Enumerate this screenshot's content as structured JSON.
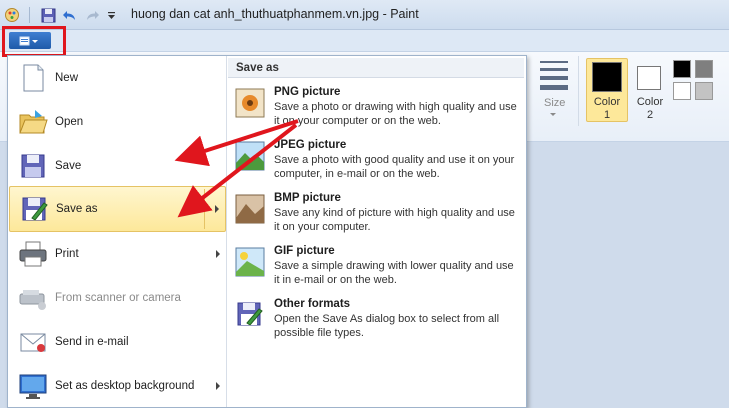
{
  "window": {
    "title": "huong dan cat anh_thuthuatphanmem.vn.jpg - Paint"
  },
  "ribbon": {
    "size_label": "Size",
    "color1_label": "Color",
    "color1_num": "1",
    "color2_label": "Color",
    "color2_num": "2",
    "palette": [
      "#000000",
      "#7f7f7f",
      "#880015",
      "#ed1c24",
      "#ffffff",
      "#c3c3c3",
      "#b97a57",
      "#ffaec9"
    ],
    "color1": "#000000",
    "color2": "#ffffff",
    "active_color_bg": "#fde89a"
  },
  "menu": {
    "items": [
      {
        "label": "New",
        "key": "N",
        "icon": "new-document-icon"
      },
      {
        "label": "Open",
        "key": "O",
        "icon": "open-folder-icon"
      },
      {
        "label": "Save",
        "key": "S",
        "icon": "save-icon"
      },
      {
        "label": "Save as",
        "key": "a",
        "icon": "save-as-icon",
        "active": true
      },
      {
        "label": "Print",
        "key": "P",
        "icon": "printer-icon"
      },
      {
        "label": "From scanner or camera",
        "key": "m",
        "icon": "scanner-icon",
        "disabled": true
      },
      {
        "label": "Send in e-mail",
        "key": "d",
        "icon": "email-icon"
      },
      {
        "label": "Set as desktop background",
        "key": "b",
        "icon": "desktop-icon"
      }
    ],
    "save_as_header": "Save as",
    "save_as_options": [
      {
        "title": "PNG picture",
        "desc": "Save a photo or drawing with high quality and use it on your computer or on the web.",
        "icon": "png-icon"
      },
      {
        "title": "JPEG picture",
        "desc": "Save a photo with good quality and use it on your computer, in e-mail or on the web.",
        "icon": "jpeg-icon"
      },
      {
        "title": "BMP picture",
        "desc": "Save any kind of picture with high quality and use it on your computer.",
        "icon": "bmp-icon"
      },
      {
        "title": "GIF picture",
        "desc": "Save a simple drawing with lower quality and use it in e-mail or on the web.",
        "icon": "gif-icon"
      },
      {
        "title": "Other formats",
        "desc": "Open the Save As dialog box to select from all possible file types.",
        "icon": "other-formats-icon"
      }
    ]
  },
  "annotations": {
    "highlight_color": "#e0161d",
    "arrow_color": "#e0161d"
  }
}
